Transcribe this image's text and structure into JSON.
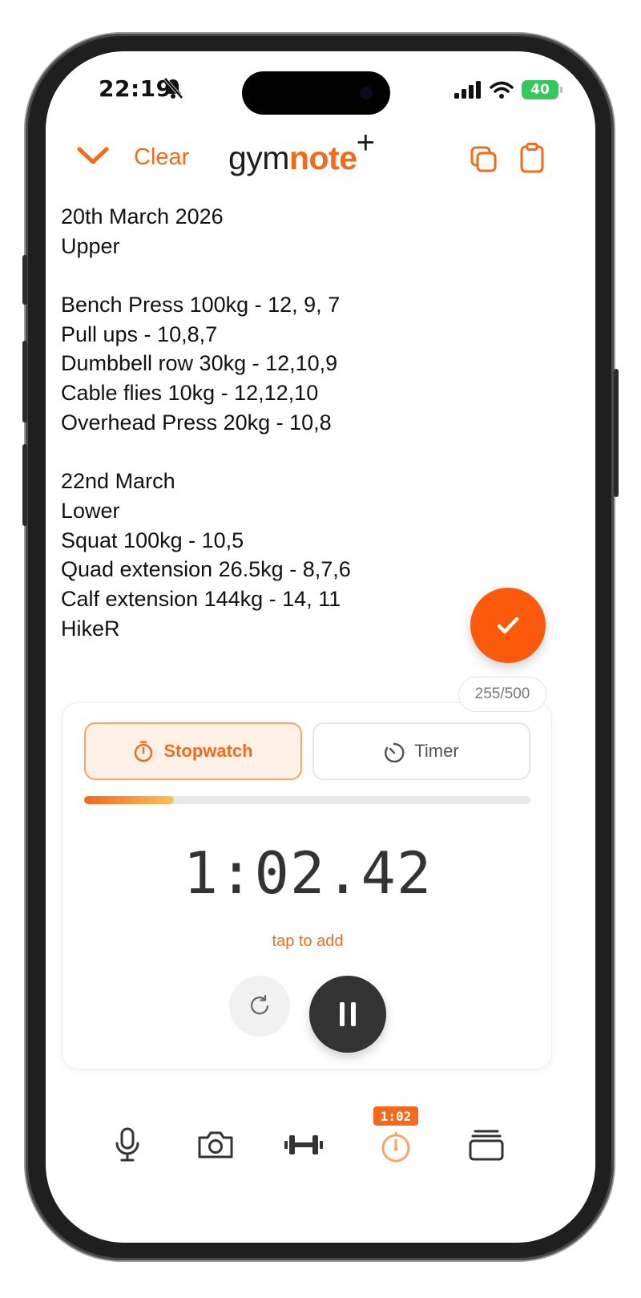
{
  "status_bar": {
    "time": "22:19",
    "battery": "40",
    "icons": [
      "bell-slash-icon",
      "signal-icon",
      "wifi-icon",
      "battery-icon"
    ]
  },
  "header": {
    "collapse_icon": "chevron-down-icon",
    "clear_label": "Clear",
    "logo": {
      "part1": "gym",
      "part2": "note",
      "plus": "+"
    },
    "copy_icon": "copy-icon",
    "clipboard_icon": "clipboard-icon"
  },
  "note": {
    "lines": [
      "20th March 2026",
      "Upper",
      "",
      "Bench Press 100kg - 12, 9, 7",
      "Pull ups - 10,8,7",
      "Dumbbell row 30kg - 12,10,9",
      "Cable flies 10kg - 12,12,10",
      "Overhead Press 20kg - 10,8",
      "",
      "22nd March",
      "Lower",
      "Squat 100kg - 10,5",
      "Quad extension 26.5kg - 8,7,6",
      "Calf extension 144kg - 14, 11",
      "HikeR"
    ]
  },
  "save_fab": {
    "icon": "checkmark-icon"
  },
  "char_counter": "255/500",
  "timer": {
    "stopwatch_label": "Stopwatch",
    "timer_label": "Timer",
    "active_mode": "stopwatch",
    "progress": 0.2,
    "display": "1:02.42",
    "tap_hint": "tap to add",
    "reset_icon": "reset-icon",
    "pause_icon": "pause-icon"
  },
  "bottom_nav": {
    "items": [
      {
        "icon": "microphone-icon"
      },
      {
        "icon": "camera-icon"
      },
      {
        "icon": "dumbbell-icon"
      },
      {
        "icon": "stopwatch-icon",
        "active": true,
        "badge": "1:02"
      },
      {
        "icon": "templates-icon"
      }
    ]
  },
  "colors": {
    "accent": "#f26a1b",
    "fab": "#fb5a0c",
    "battery": "#34c759",
    "dark_button": "#333333"
  }
}
